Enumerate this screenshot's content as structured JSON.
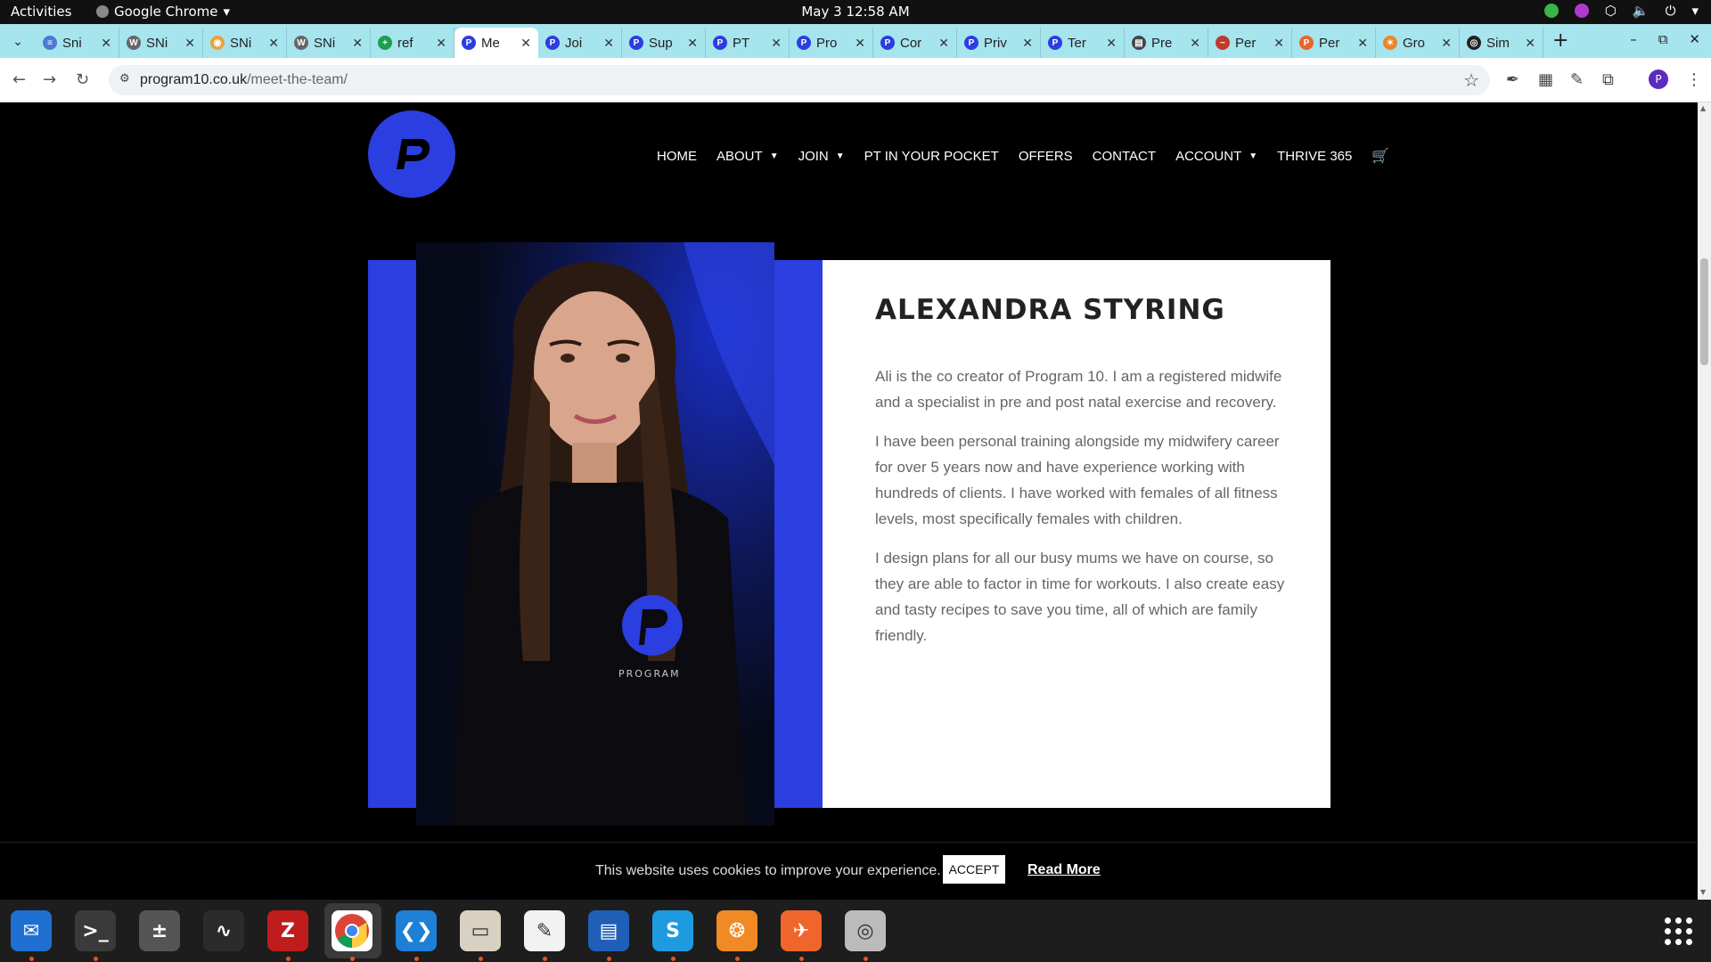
{
  "topbar": {
    "activities": "Activities",
    "app_name": "Google Chrome",
    "clock": "May 3  12:58 AM"
  },
  "tabs": [
    {
      "title": "Sni",
      "fav_color": "#4a7bd8",
      "fav_glyph": "≡"
    },
    {
      "title": "SNi",
      "fav_color": "#666666",
      "fav_glyph": "W"
    },
    {
      "title": "SNi",
      "fav_color": "#e8a33d",
      "fav_glyph": "◉"
    },
    {
      "title": "SNi",
      "fav_color": "#666666",
      "fav_glyph": "W"
    },
    {
      "title": "ref",
      "fav_color": "#1e9e4f",
      "fav_glyph": "+"
    },
    {
      "title": "Me",
      "fav_color": "#2b3ee0",
      "fav_glyph": "P",
      "active": true
    },
    {
      "title": "Joi",
      "fav_color": "#2b3ee0",
      "fav_glyph": "P"
    },
    {
      "title": "Sup",
      "fav_color": "#2b3ee0",
      "fav_glyph": "P"
    },
    {
      "title": "PT",
      "fav_color": "#2b3ee0",
      "fav_glyph": "P"
    },
    {
      "title": "Pro",
      "fav_color": "#2b3ee0",
      "fav_glyph": "P"
    },
    {
      "title": "Cor",
      "fav_color": "#2b3ee0",
      "fav_glyph": "P"
    },
    {
      "title": "Priv",
      "fav_color": "#2b3ee0",
      "fav_glyph": "P"
    },
    {
      "title": "Ter",
      "fav_color": "#2b3ee0",
      "fav_glyph": "P"
    },
    {
      "title": "Pre",
      "fav_color": "#444444",
      "fav_glyph": "▤"
    },
    {
      "title": "Per",
      "fav_color": "#c0392b",
      "fav_glyph": "~"
    },
    {
      "title": "Per",
      "fav_color": "#e8662b",
      "fav_glyph": "P"
    },
    {
      "title": "Gro",
      "fav_color": "#e8862b",
      "fav_glyph": "✶"
    },
    {
      "title": "Sim",
      "fav_color": "#222222",
      "fav_glyph": "◎"
    }
  ],
  "toolbar": {
    "url_host": "program10.co.uk",
    "url_path": "/meet-the-team/"
  },
  "site": {
    "logo_letter": "P",
    "brand_color": "#2b3ee0",
    "nav": [
      {
        "label": "HOME",
        "dropdown": false
      },
      {
        "label": "ABOUT",
        "dropdown": true
      },
      {
        "label": "JOIN",
        "dropdown": true
      },
      {
        "label": "PT IN YOUR POCKET",
        "dropdown": false
      },
      {
        "label": "OFFERS",
        "dropdown": false
      },
      {
        "label": "CONTACT",
        "dropdown": false
      },
      {
        "label": "ACCOUNT",
        "dropdown": true
      },
      {
        "label": "THRIVE 365",
        "dropdown": false
      }
    ],
    "photo_shirt_text": "PROGRAM"
  },
  "bio": {
    "name": "ALEXANDRA STYRING",
    "paragraphs": [
      "Ali is the co creator of Program 10. I am a registered midwife and a specialist in pre and post natal exercise and recovery.",
      "I have been personal training alongside my midwifery career for over 5 years now and have experience working with hundreds of clients. I have worked with females of all fitness levels, most specifically females with children.",
      "I design plans for all our busy mums we have on course, so they are able to factor in time for workouts. I also create easy and tasty recipes to save you time, all of which are family friendly."
    ]
  },
  "cookie": {
    "message": "This website uses cookies to improve your experience.",
    "accept": "ACCEPT",
    "read_more": "Read More"
  },
  "dock": [
    {
      "name": "thunderbird",
      "color": "#1f6fd1",
      "glyph": "✉"
    },
    {
      "name": "terminal",
      "color": "#3a3a3a",
      "glyph": ">_"
    },
    {
      "name": "calculator",
      "color": "#555555",
      "glyph": "±"
    },
    {
      "name": "system-monitor",
      "color": "#2b2b2b",
      "glyph": "∿"
    },
    {
      "name": "filezilla",
      "color": "#bf1d1d",
      "glyph": "Z"
    },
    {
      "name": "chrome",
      "color": "#ffffff",
      "glyph": ""
    },
    {
      "name": "vscode",
      "color": "#1e7fd6",
      "glyph": "❮❯"
    },
    {
      "name": "files",
      "color": "#d8d0c0",
      "glyph": "▭"
    },
    {
      "name": "text-editor",
      "color": "#f2f2f2",
      "glyph": "✎"
    },
    {
      "name": "libreoffice-writer",
      "color": "#1f5fb8",
      "glyph": "▤"
    },
    {
      "name": "skype",
      "color": "#1e9be0",
      "glyph": "S"
    },
    {
      "name": "blender-like",
      "color": "#f08a24",
      "glyph": "❂"
    },
    {
      "name": "postman",
      "color": "#f0652b",
      "glyph": "✈"
    },
    {
      "name": "disk-utility",
      "color": "#bbbbbb",
      "glyph": "◎"
    }
  ]
}
